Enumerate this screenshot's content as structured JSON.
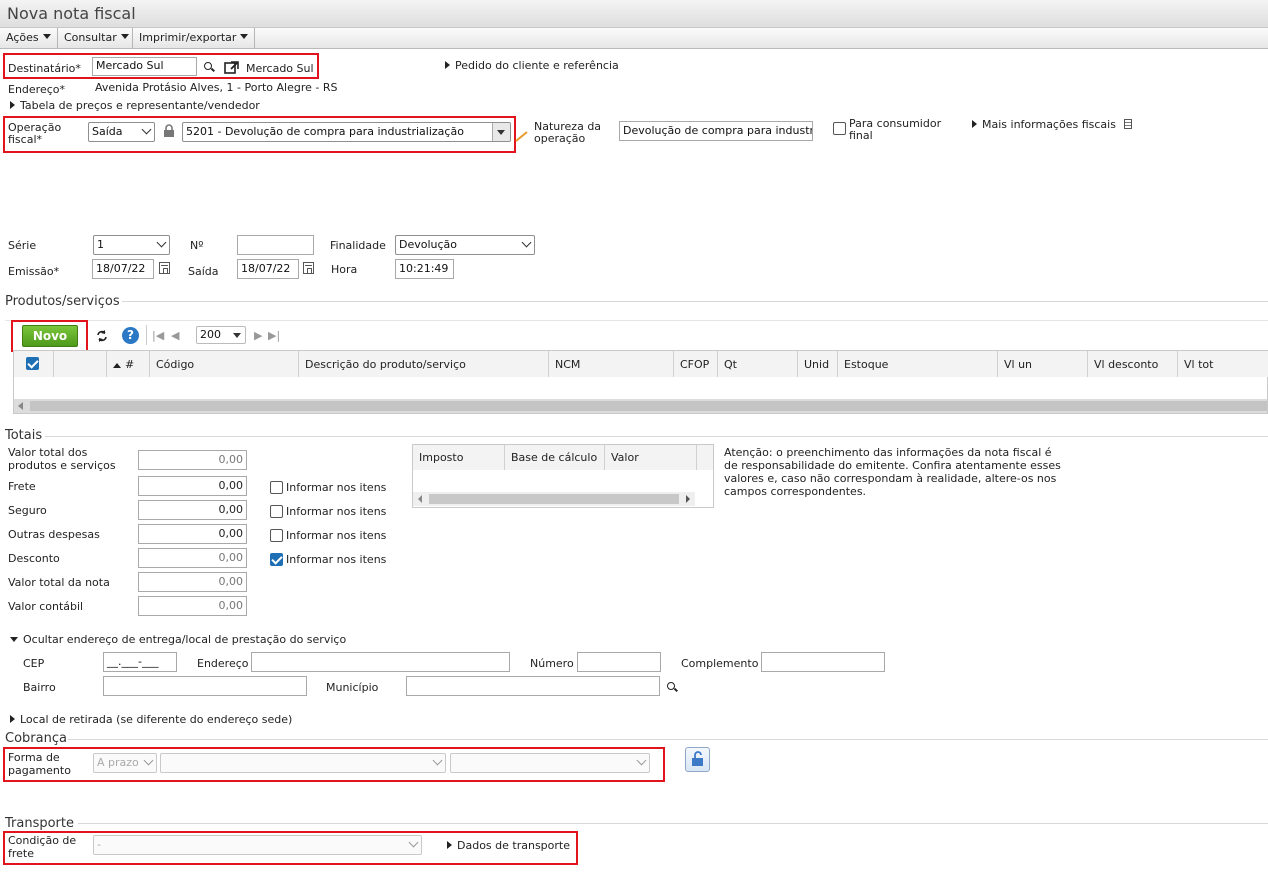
{
  "window": {
    "title": "Nova nota fiscal"
  },
  "menubar": {
    "items": [
      "Ações",
      "Consultar",
      "Imprimir/exportar"
    ]
  },
  "destinatario": {
    "label": "Destinatário*",
    "value": "Mercado Sul",
    "link_text": "Mercado Sul",
    "endereco_label": "Endereço*",
    "endereco_value": "Avenida Protásio Alves, 1 - Porto Alegre - RS",
    "tabela_precos": "Tabela de preços e representante/vendedor",
    "pedido_cliente": "Pedido do cliente e referência"
  },
  "operacao": {
    "label_line1": "Operação",
    "label_line2": "fiscal*",
    "tipo": "Saída",
    "cfop": "5201 - Devolução de compra para industrialização",
    "natureza_line1": "Natureza da",
    "natureza_line2": "operação",
    "natureza_value": "Devolução de compra para industrialização",
    "consumidor_line1": "Para consumidor",
    "consumidor_line2": "final",
    "mais_info": "Mais informações fiscais"
  },
  "documento": {
    "serie_label": "Série",
    "serie_value": "1",
    "numero_label": "Nº",
    "numero_value": "",
    "finalidade_label": "Finalidade",
    "finalidade_value": "Devolução",
    "emissao_label": "Emissão*",
    "emissao_value": "18/07/22",
    "saida_label": "Saída",
    "saida_value": "18/07/22",
    "hora_label": "Hora",
    "hora_value": "10:21:49"
  },
  "produtos": {
    "title": "Produtos/serviços",
    "novo_label": "Novo",
    "page_size": "200",
    "columns": [
      "#",
      "Código",
      "Descrição do produto/serviço",
      "NCM",
      "CFOP",
      "Qt",
      "Unid",
      "Estoque",
      "Vl un",
      "Vl desconto",
      "Vl tot"
    ]
  },
  "totais": {
    "title": "Totais",
    "rows": [
      {
        "label": "Valor total dos produtos e serviços",
        "value": "0,00"
      },
      {
        "label": "Frete",
        "value": "0,00",
        "check_label": "Informar nos itens",
        "checked": false
      },
      {
        "label": "Seguro",
        "value": "0,00",
        "check_label": "Informar nos itens",
        "checked": false
      },
      {
        "label": "Outras despesas",
        "value": "0,00",
        "check_label": "Informar nos itens",
        "checked": false
      },
      {
        "label": "Desconto",
        "value": "0,00",
        "check_label": "Informar nos itens",
        "checked": true
      },
      {
        "label": "Valor total da nota",
        "value": "0,00"
      },
      {
        "label": "Valor contábil",
        "value": "0,00"
      }
    ],
    "label_line1": "Valor total dos",
    "label_line2": "produtos e serviços",
    "imposto_columns": [
      "Imposto",
      "Base de cálculo",
      "Valor"
    ],
    "atencao": "Atenção: o preenchimento das informações da nota fiscal é de responsabilidade do emitente. Confira atentamente esses valores e, caso não correspondam à realidade, altere-os nos campos correspondentes."
  },
  "entrega": {
    "toggle": "Ocultar endereço de entrega/local de prestação do serviço",
    "cep_label": "CEP",
    "cep_placeholder": "__.___-___",
    "endereco_label": "Endereço",
    "numero_label": "Número",
    "complemento_label": "Complemento",
    "bairro_label": "Bairro",
    "municipio_label": "Município",
    "retirada": "Local de retirada (se diferente do endereço sede)"
  },
  "cobranca": {
    "title": "Cobrança",
    "label_line1": "Forma de",
    "label_line2": "pagamento",
    "tipo": "A prazo"
  },
  "transporte": {
    "title": "Transporte",
    "label_line1": "Condição de",
    "label_line2": "frete",
    "value": "-",
    "dados": "Dados de transporte"
  },
  "colors": {
    "highlight": "#e1141e",
    "novo_green": "#5aa820",
    "check_blue": "#1f6fb5"
  }
}
